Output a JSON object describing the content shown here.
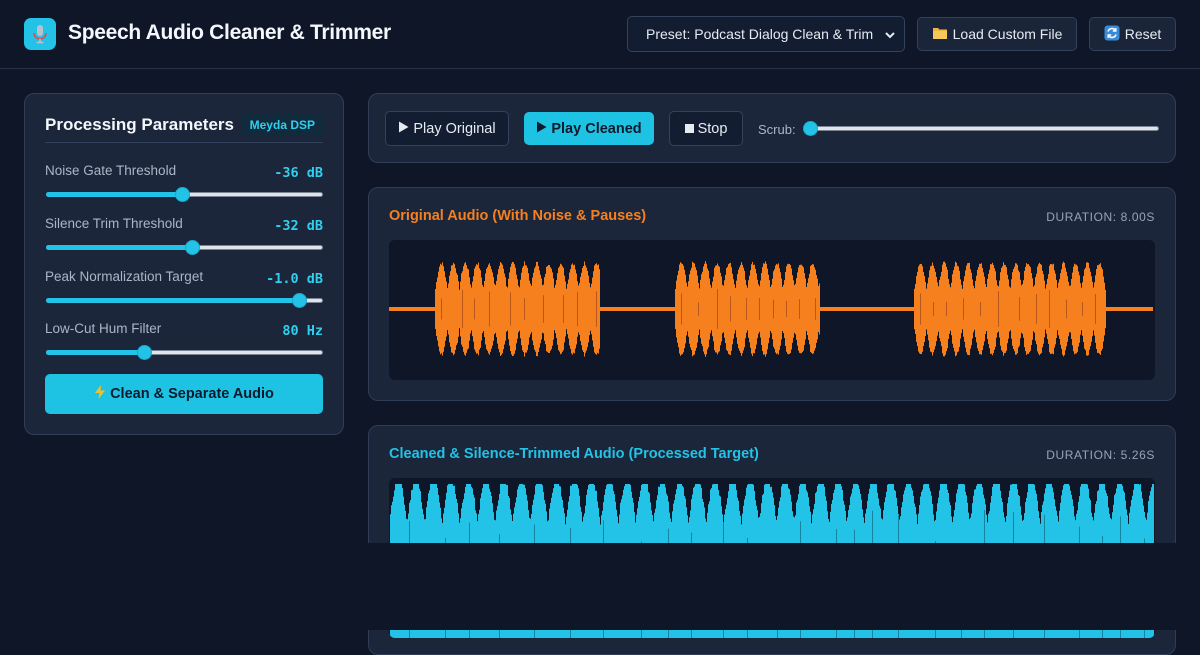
{
  "header": {
    "title": "Speech Audio Cleaner & Trimmer",
    "preset_value": "Preset: Podcast Dialog Clean & Trim",
    "load_label": "Load Custom File",
    "reset_label": "Reset",
    "logo_icon": "microphone-icon"
  },
  "params": {
    "title": "Processing Parameters",
    "badge": "Meyda DSP",
    "items": [
      {
        "label": "Noise Gate Threshold",
        "value": "-36 dB",
        "level": 0.48
      },
      {
        "label": "Silence Trim Threshold",
        "value": "-32 dB",
        "level": 0.515
      },
      {
        "label": "Peak Normalization Target",
        "value": "-1.0 dB",
        "level": 0.9
      },
      {
        "label": "Low-Cut Hum Filter",
        "value": "80 Hz",
        "level": 0.34
      }
    ],
    "action_label": "Clean & Separate Audio",
    "action_icon": "lightning-icon"
  },
  "transport": {
    "play_original": "Play Original",
    "play_cleaned": "Play Cleaned",
    "stop": "Stop",
    "scrub_label": "Scrub:",
    "scrub_position": 0
  },
  "original": {
    "title": "Original Audio (With Noise & Pauses)",
    "duration": "DURATION: 8.00S",
    "color": "#f7801e"
  },
  "cleaned": {
    "title": "Cleaned & Silence-Trimmed Audio (Processed Target)",
    "duration": "DURATION: 5.26S",
    "color": "#22c3e6"
  },
  "colors": {
    "background": "#0e1628",
    "panel": "#1b263a",
    "accent": "#1ec3e4",
    "orange": "#f7801e"
  }
}
